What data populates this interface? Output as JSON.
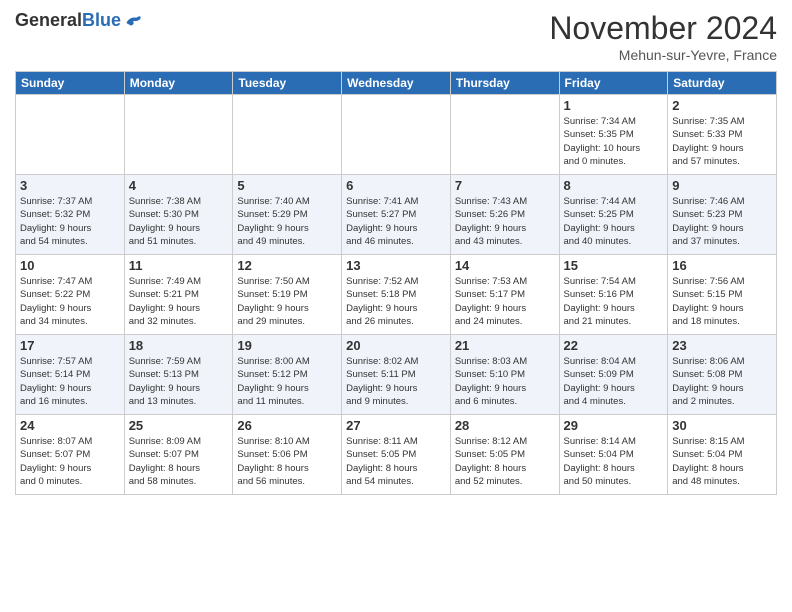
{
  "header": {
    "logo_general": "General",
    "logo_blue": "Blue",
    "month_title": "November 2024",
    "location": "Mehun-sur-Yevre, France"
  },
  "weekdays": [
    "Sunday",
    "Monday",
    "Tuesday",
    "Wednesday",
    "Thursday",
    "Friday",
    "Saturday"
  ],
  "rows": [
    {
      "alt": false,
      "days": [
        {
          "num": "",
          "info": ""
        },
        {
          "num": "",
          "info": ""
        },
        {
          "num": "",
          "info": ""
        },
        {
          "num": "",
          "info": ""
        },
        {
          "num": "",
          "info": ""
        },
        {
          "num": "1",
          "info": "Sunrise: 7:34 AM\nSunset: 5:35 PM\nDaylight: 10 hours\nand 0 minutes."
        },
        {
          "num": "2",
          "info": "Sunrise: 7:35 AM\nSunset: 5:33 PM\nDaylight: 9 hours\nand 57 minutes."
        }
      ]
    },
    {
      "alt": true,
      "days": [
        {
          "num": "3",
          "info": "Sunrise: 7:37 AM\nSunset: 5:32 PM\nDaylight: 9 hours\nand 54 minutes."
        },
        {
          "num": "4",
          "info": "Sunrise: 7:38 AM\nSunset: 5:30 PM\nDaylight: 9 hours\nand 51 minutes."
        },
        {
          "num": "5",
          "info": "Sunrise: 7:40 AM\nSunset: 5:29 PM\nDaylight: 9 hours\nand 49 minutes."
        },
        {
          "num": "6",
          "info": "Sunrise: 7:41 AM\nSunset: 5:27 PM\nDaylight: 9 hours\nand 46 minutes."
        },
        {
          "num": "7",
          "info": "Sunrise: 7:43 AM\nSunset: 5:26 PM\nDaylight: 9 hours\nand 43 minutes."
        },
        {
          "num": "8",
          "info": "Sunrise: 7:44 AM\nSunset: 5:25 PM\nDaylight: 9 hours\nand 40 minutes."
        },
        {
          "num": "9",
          "info": "Sunrise: 7:46 AM\nSunset: 5:23 PM\nDaylight: 9 hours\nand 37 minutes."
        }
      ]
    },
    {
      "alt": false,
      "days": [
        {
          "num": "10",
          "info": "Sunrise: 7:47 AM\nSunset: 5:22 PM\nDaylight: 9 hours\nand 34 minutes."
        },
        {
          "num": "11",
          "info": "Sunrise: 7:49 AM\nSunset: 5:21 PM\nDaylight: 9 hours\nand 32 minutes."
        },
        {
          "num": "12",
          "info": "Sunrise: 7:50 AM\nSunset: 5:19 PM\nDaylight: 9 hours\nand 29 minutes."
        },
        {
          "num": "13",
          "info": "Sunrise: 7:52 AM\nSunset: 5:18 PM\nDaylight: 9 hours\nand 26 minutes."
        },
        {
          "num": "14",
          "info": "Sunrise: 7:53 AM\nSunset: 5:17 PM\nDaylight: 9 hours\nand 24 minutes."
        },
        {
          "num": "15",
          "info": "Sunrise: 7:54 AM\nSunset: 5:16 PM\nDaylight: 9 hours\nand 21 minutes."
        },
        {
          "num": "16",
          "info": "Sunrise: 7:56 AM\nSunset: 5:15 PM\nDaylight: 9 hours\nand 18 minutes."
        }
      ]
    },
    {
      "alt": true,
      "days": [
        {
          "num": "17",
          "info": "Sunrise: 7:57 AM\nSunset: 5:14 PM\nDaylight: 9 hours\nand 16 minutes."
        },
        {
          "num": "18",
          "info": "Sunrise: 7:59 AM\nSunset: 5:13 PM\nDaylight: 9 hours\nand 13 minutes."
        },
        {
          "num": "19",
          "info": "Sunrise: 8:00 AM\nSunset: 5:12 PM\nDaylight: 9 hours\nand 11 minutes."
        },
        {
          "num": "20",
          "info": "Sunrise: 8:02 AM\nSunset: 5:11 PM\nDaylight: 9 hours\nand 9 minutes."
        },
        {
          "num": "21",
          "info": "Sunrise: 8:03 AM\nSunset: 5:10 PM\nDaylight: 9 hours\nand 6 minutes."
        },
        {
          "num": "22",
          "info": "Sunrise: 8:04 AM\nSunset: 5:09 PM\nDaylight: 9 hours\nand 4 minutes."
        },
        {
          "num": "23",
          "info": "Sunrise: 8:06 AM\nSunset: 5:08 PM\nDaylight: 9 hours\nand 2 minutes."
        }
      ]
    },
    {
      "alt": false,
      "days": [
        {
          "num": "24",
          "info": "Sunrise: 8:07 AM\nSunset: 5:07 PM\nDaylight: 9 hours\nand 0 minutes."
        },
        {
          "num": "25",
          "info": "Sunrise: 8:09 AM\nSunset: 5:07 PM\nDaylight: 8 hours\nand 58 minutes."
        },
        {
          "num": "26",
          "info": "Sunrise: 8:10 AM\nSunset: 5:06 PM\nDaylight: 8 hours\nand 56 minutes."
        },
        {
          "num": "27",
          "info": "Sunrise: 8:11 AM\nSunset: 5:05 PM\nDaylight: 8 hours\nand 54 minutes."
        },
        {
          "num": "28",
          "info": "Sunrise: 8:12 AM\nSunset: 5:05 PM\nDaylight: 8 hours\nand 52 minutes."
        },
        {
          "num": "29",
          "info": "Sunrise: 8:14 AM\nSunset: 5:04 PM\nDaylight: 8 hours\nand 50 minutes."
        },
        {
          "num": "30",
          "info": "Sunrise: 8:15 AM\nSunset: 5:04 PM\nDaylight: 8 hours\nand 48 minutes."
        }
      ]
    }
  ]
}
